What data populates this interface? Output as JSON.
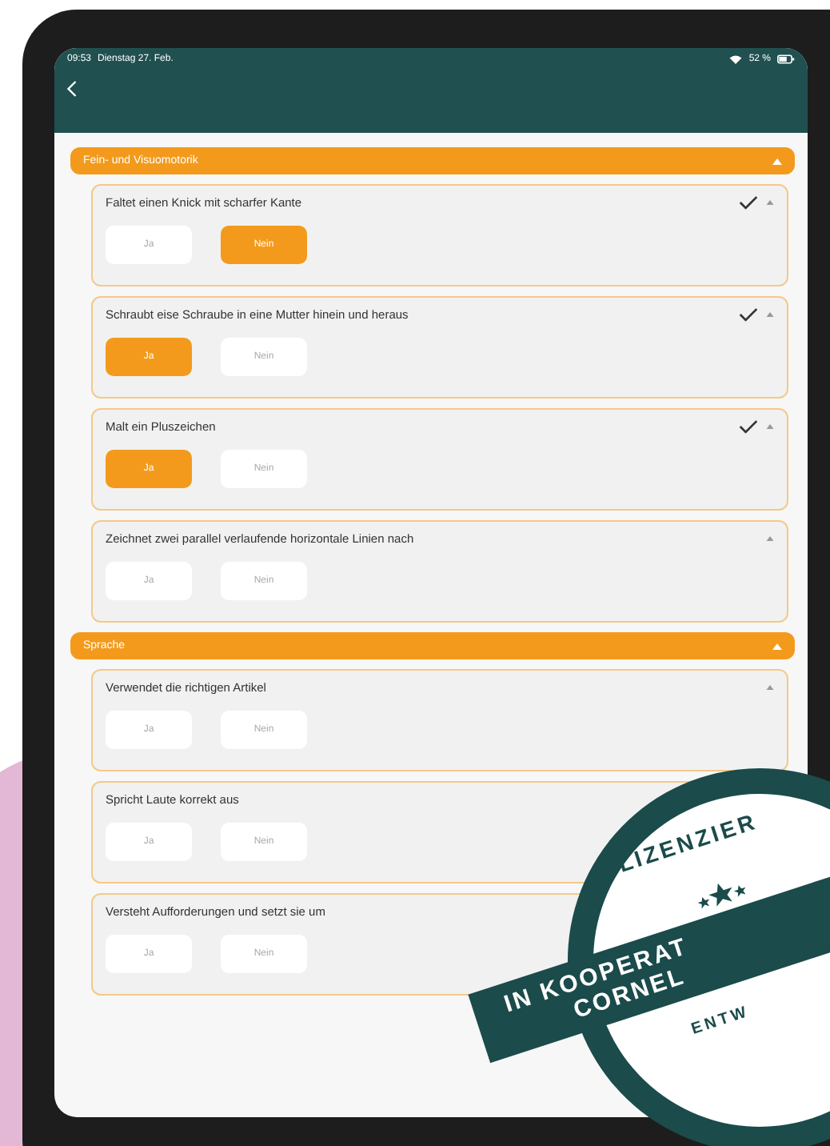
{
  "status_bar": {
    "time": "09:53",
    "date": "Dienstag 27. Feb.",
    "battery": "52 %"
  },
  "sections": [
    {
      "title": "Fein- und Visuomotorik",
      "expanded": true,
      "items": [
        {
          "question": "Faltet einen Knick mit scharfer Kante",
          "checked": true,
          "expanded": true,
          "options": [
            {
              "label": "Ja",
              "selected": false
            },
            {
              "label": "Nein",
              "selected": true
            }
          ]
        },
        {
          "question": "Schraubt eise Schraube in eine Mutter hinein und heraus",
          "checked": true,
          "expanded": true,
          "options": [
            {
              "label": "Ja",
              "selected": true
            },
            {
              "label": "Nein",
              "selected": false
            }
          ]
        },
        {
          "question": "Malt ein Pluszeichen",
          "checked": true,
          "expanded": true,
          "options": [
            {
              "label": "Ja",
              "selected": true
            },
            {
              "label": "Nein",
              "selected": false
            }
          ]
        },
        {
          "question": "Zeichnet zwei parallel verlaufende horizontale Linien nach",
          "checked": false,
          "expanded": true,
          "options": [
            {
              "label": "Ja",
              "selected": false
            },
            {
              "label": "Nein",
              "selected": false
            }
          ]
        }
      ]
    },
    {
      "title": "Sprache",
      "expanded": true,
      "items": [
        {
          "question": "Verwendet die richtigen Artikel",
          "checked": false,
          "expanded": true,
          "options": [
            {
              "label": "Ja",
              "selected": false
            },
            {
              "label": "Nein",
              "selected": false
            }
          ]
        },
        {
          "question": "Spricht Laute korrekt aus",
          "checked": false,
          "expanded": true,
          "options": [
            {
              "label": "Ja",
              "selected": false
            },
            {
              "label": "Nein",
              "selected": false
            }
          ]
        },
        {
          "question": "Versteht Aufforderungen und setzt sie um",
          "checked": false,
          "expanded": true,
          "options": [
            {
              "label": "Ja",
              "selected": false
            },
            {
              "label": "Nein",
              "selected": false
            }
          ]
        }
      ]
    }
  ],
  "badge": {
    "top_text": "LIZENZIER",
    "ribbon_lines": [
      "IN KOOPERAT",
      "CORNEL"
    ],
    "bottom_text": "ENTW"
  }
}
